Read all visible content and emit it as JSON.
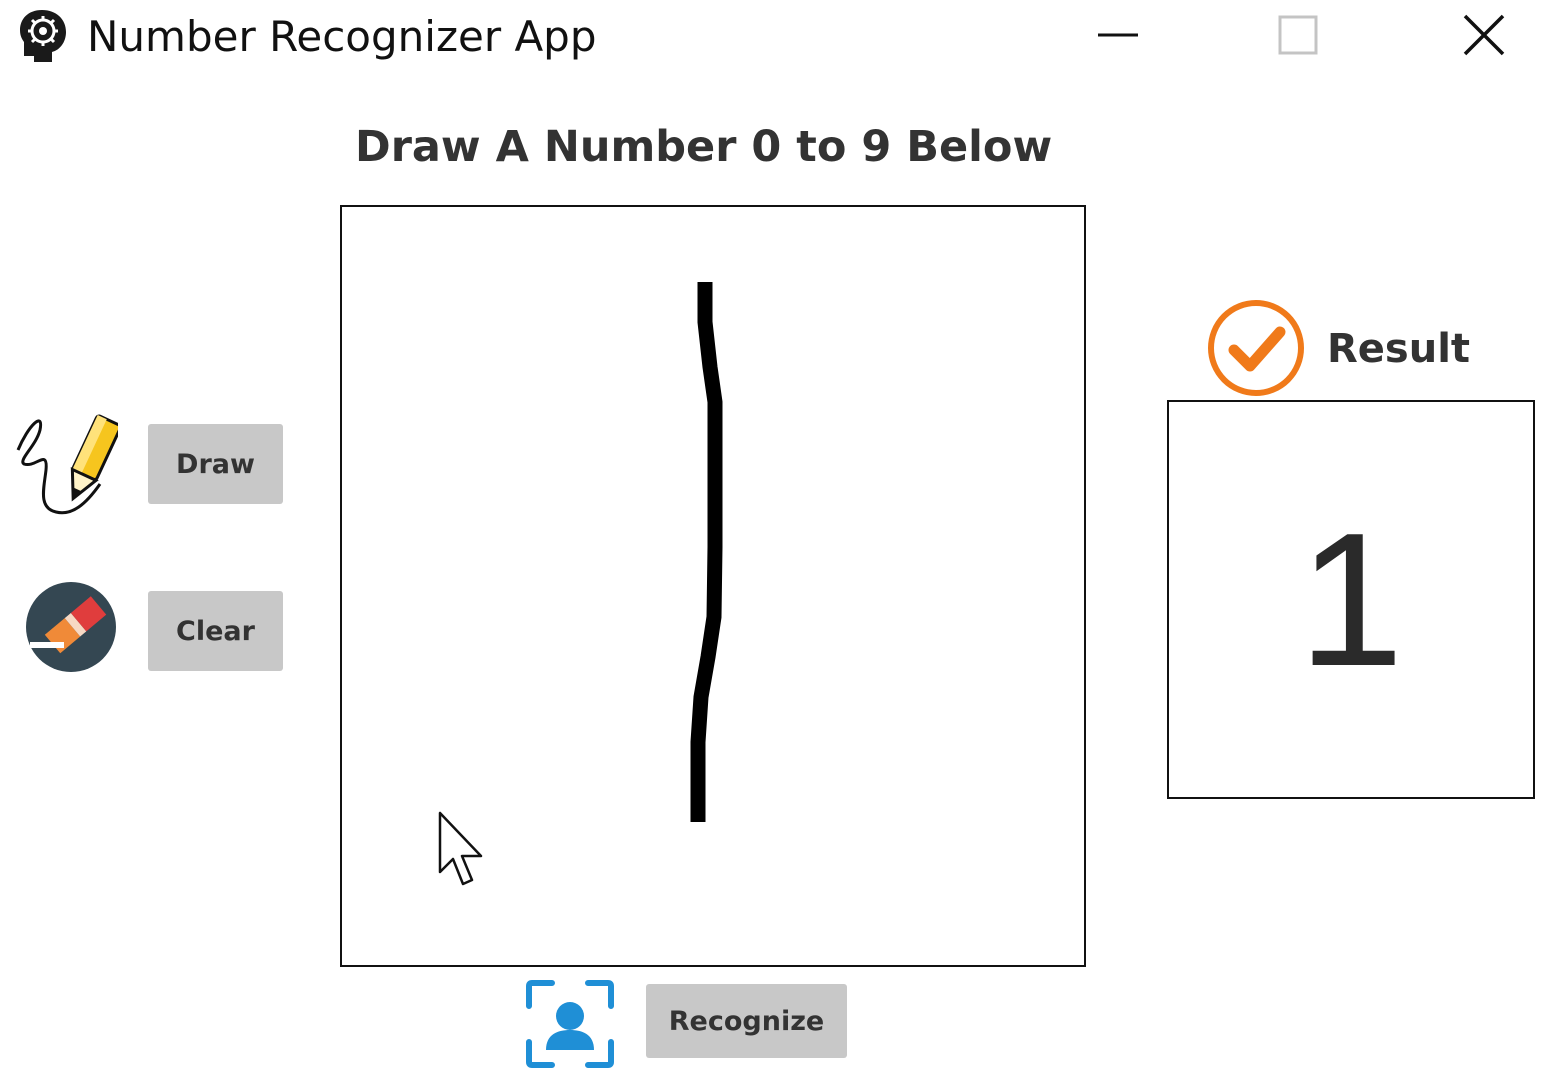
{
  "window": {
    "title": "Number Recognizer App",
    "app_icon": "brain-gear-icon",
    "controls": [
      "minimize-icon",
      "maximize-icon",
      "close-icon"
    ]
  },
  "heading": "Draw A Number 0 to 9 Below",
  "tools": {
    "draw_label": "Draw",
    "draw_icon": "pencil-icon",
    "clear_label": "Clear",
    "clear_icon": "eraser-icon"
  },
  "recognize": {
    "label": "Recognize",
    "icon": "face-scan-icon"
  },
  "result": {
    "label": "Result",
    "icon": "check-circle-icon",
    "value": "1"
  },
  "colors": {
    "button_bg": "#c8c8c8",
    "accent_orange": "#f07a1a",
    "scan_blue": "#1f8fd6",
    "eraser_dark": "#344752"
  }
}
